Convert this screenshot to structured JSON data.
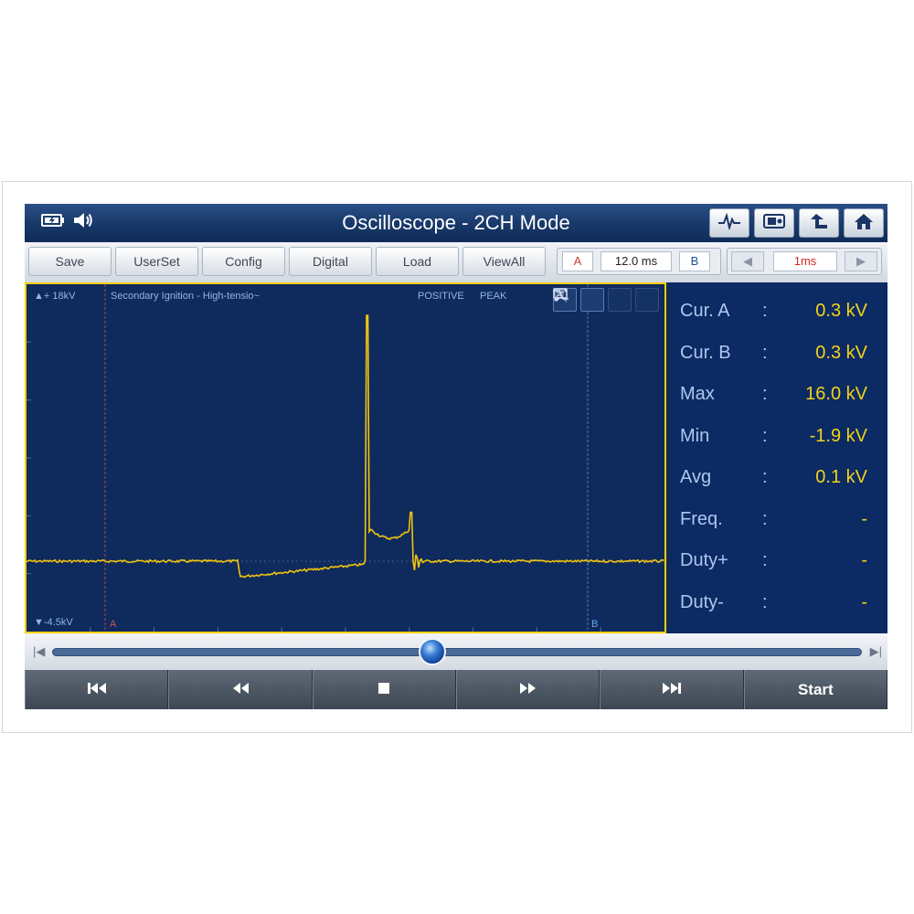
{
  "window": {
    "title": "Oscilloscope - 2CH Mode"
  },
  "toolbar": {
    "buttons": [
      "Save",
      "UserSet",
      "Config",
      "Digital",
      "Load",
      "ViewAll"
    ],
    "cursor_a_label": "A",
    "cursor_span": "12.0 ms",
    "cursor_b_label": "B",
    "timebase": "1ms"
  },
  "plot": {
    "y_top_label": "▲+ 18kV",
    "y_bottom_label": "▼-4.5kV",
    "channel_name": "Secondary Ignition - High-tensio~",
    "trigger_polarity": "POSITIVE",
    "mode": "PEAK",
    "cursor_a_marker": "A",
    "cursor_b_marker": "B",
    "trace_color": "#f1c40f"
  },
  "readout": [
    {
      "label": "Cur. A",
      "sep": ":",
      "value": "0.3 kV"
    },
    {
      "label": "Cur. B",
      "sep": ":",
      "value": "0.3 kV"
    },
    {
      "label": "Max",
      "sep": ":",
      "value": "16.0 kV"
    },
    {
      "label": "Min",
      "sep": ":",
      "value": "-1.9 kV"
    },
    {
      "label": "Avg",
      "sep": ":",
      "value": "0.1 kV"
    },
    {
      "label": "Freq.",
      "sep": ":",
      "value": "-"
    },
    {
      "label": "Duty+",
      "sep": ":",
      "value": "-"
    },
    {
      "label": "Duty-",
      "sep": ":",
      "value": "-"
    }
  ],
  "playback": {
    "position_fraction": 0.47
  },
  "transport": {
    "start_label": "Start"
  },
  "icons": [
    "battery-icon",
    "speaker-icon",
    "waveform-icon",
    "screenshot-icon",
    "back-icon",
    "home-icon",
    "comment-icon",
    "cursor-toggle-icon",
    "zoom-icon",
    "close-icon",
    "skip-start-icon",
    "rewind-icon",
    "stop-icon",
    "fast-forward-icon",
    "skip-end-icon"
  ]
}
